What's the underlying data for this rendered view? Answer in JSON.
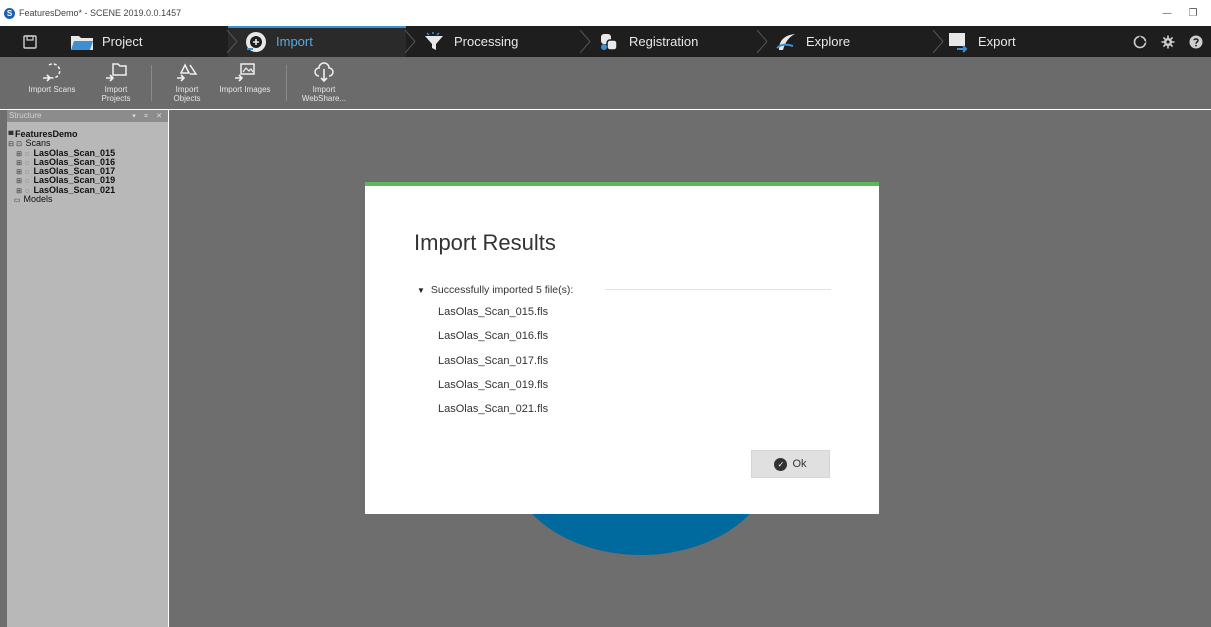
{
  "window": {
    "title": "FeaturesDemo* - SCENE 2019.0.0.1457",
    "minimize": "—",
    "restore": "❐"
  },
  "workflow": {
    "tabs": [
      {
        "label": "Project"
      },
      {
        "label": "Import"
      },
      {
        "label": "Processing"
      },
      {
        "label": "Registration"
      },
      {
        "label": "Explore"
      },
      {
        "label": "Export"
      }
    ],
    "active_tab": "Import",
    "right_icons": [
      "tour-icon",
      "settings-gear-icon",
      "help-icon"
    ]
  },
  "ribbon": {
    "buttons": [
      {
        "label": "Import Scans"
      },
      {
        "label": "Import\nProjects"
      },
      {
        "label": "Import\nObjects"
      },
      {
        "label": "Import Images"
      },
      {
        "label": "Import\nWebShare..."
      }
    ]
  },
  "structure": {
    "title": "Structure",
    "controls": "▾ ⌗ ✕",
    "root": "FeaturesDemo",
    "scans_label": "Scans",
    "scans": [
      "LasOlas_Scan_015",
      "LasOlas_Scan_016",
      "LasOlas_Scan_017",
      "LasOlas_Scan_019",
      "LasOlas_Scan_021"
    ],
    "models_label": "Models"
  },
  "dialog": {
    "title": "Import Results",
    "section_label": "Successfully imported 5 file(s):",
    "files": [
      "LasOlas_Scan_015.fls",
      "LasOlas_Scan_016.fls",
      "LasOlas_Scan_017.fls",
      "LasOlas_Scan_019.fls",
      "LasOlas_Scan_021.fls"
    ],
    "ok_label": "Ok",
    "accent_color": "#5cb85c"
  },
  "colors": {
    "workflow_bg": "#1e1e1e",
    "active_tab": "#5aa9e0",
    "ribbon_bg": "#6b6b6b",
    "panel_bg": "#b8b8b8",
    "main_bg": "#6e6e6e",
    "circle": "#006a9e"
  }
}
